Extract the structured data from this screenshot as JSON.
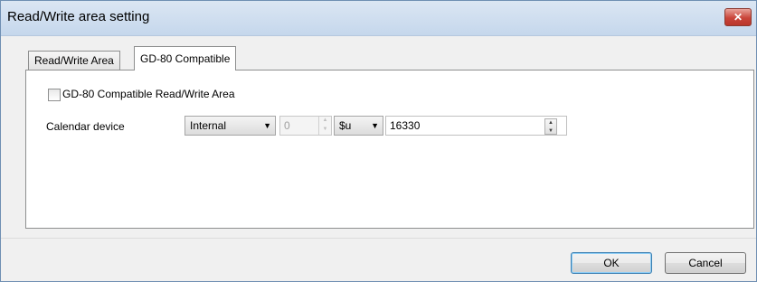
{
  "window": {
    "title": "Read/Write area setting",
    "close_glyph": "✕"
  },
  "tabs": [
    {
      "label": "Read/Write Area",
      "active": false
    },
    {
      "label": "GD-80 Compatible",
      "active": true
    }
  ],
  "panel": {
    "checkbox_label": "GD-80 Compatible Read/Write Area",
    "checkbox_checked": false,
    "calendar_label": "Calendar device",
    "device_type": "Internal",
    "device_number": "0",
    "device_prefix": "$u",
    "address": "16330"
  },
  "buttons": {
    "ok": "OK",
    "cancel": "Cancel"
  },
  "icons": {
    "dropdown": "chevron-down-icon",
    "spin_up": "▲",
    "spin_down": "▼",
    "dropdown_glyph": "▼"
  }
}
